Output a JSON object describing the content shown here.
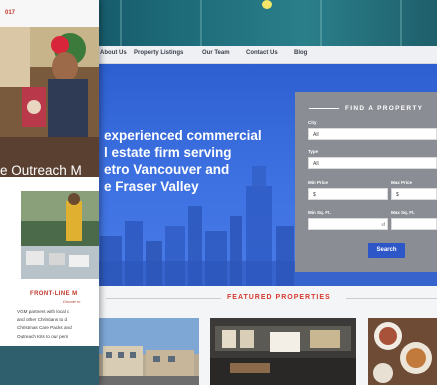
{
  "nav": {
    "items": [
      "About Us",
      "Property Listings",
      "Our Team",
      "Contact Us",
      "Blog"
    ]
  },
  "hero": {
    "lines": [
      "experienced commercial",
      "l estate firm serving",
      "etro Vancouver and",
      "e Fraser Valley"
    ]
  },
  "find_property": {
    "title": "FIND A PROPERTY",
    "city_label": "City",
    "city_value": "All",
    "type_label": "Type",
    "type_value": "All",
    "min_price_label": "Min Price",
    "min_price_value": "$",
    "max_price_label": "Max Price",
    "max_price_value": "$",
    "min_sqft_label": "Min Sq. Ft.",
    "max_sqft_label": "Max Sq. Ft.",
    "sqft_unit": "sf",
    "search_label": "Search"
  },
  "featured": {
    "title": "FEATURED PROPERTIES"
  },
  "card": {
    "year": "017",
    "outreach_text": "e Outreach M",
    "frontline_title": "FRONT-LINE M",
    "frontline_sub": "Donate to",
    "frontline_body": [
      "VGM partners with local c",
      "and other Christians to d",
      "Christmas Care Packs and",
      "Outreach Kits to our pers"
    ]
  },
  "colors": {
    "hero_blue": "#3b6fe0",
    "accent_red": "#d73a2f",
    "search_button": "#2d56c8",
    "panel_gray": "#8a8d94"
  }
}
